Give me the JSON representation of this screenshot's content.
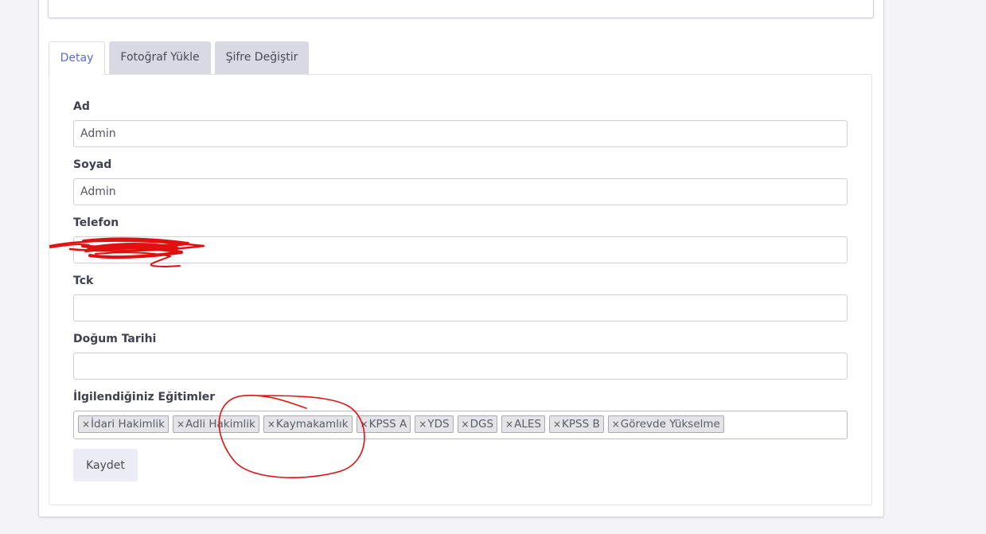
{
  "tabs": [
    {
      "label": "Detay",
      "active": true
    },
    {
      "label": "Fotoğraf Yükle",
      "active": false
    },
    {
      "label": "Şifre Değiştir",
      "active": false
    }
  ],
  "form": {
    "first_name": {
      "label": "Ad",
      "value": "Admin"
    },
    "last_name": {
      "label": "Soyad",
      "value": "Admin"
    },
    "phone": {
      "label": "Telefon",
      "value": ""
    },
    "tck": {
      "label": "Tck",
      "value": ""
    },
    "birth_date": {
      "label": "Doğum Tarihi",
      "value": ""
    },
    "trainings": {
      "label": "İlgilendiğiniz Eğitimler",
      "remove_symbol": "×",
      "tags": [
        "İdari Hakimlik",
        "Adli Hakimlik",
        "Kaymakamlık",
        "KPSS A",
        "YDS",
        "DGS",
        "ALES",
        "KPSS B",
        "Görevde Yükselme"
      ]
    },
    "save_label": "Kaydet"
  },
  "colors": {
    "active_tab_text": "#5a6bd6",
    "inactive_tab_bg": "#d9d9e3",
    "annotation": "#e01010"
  }
}
